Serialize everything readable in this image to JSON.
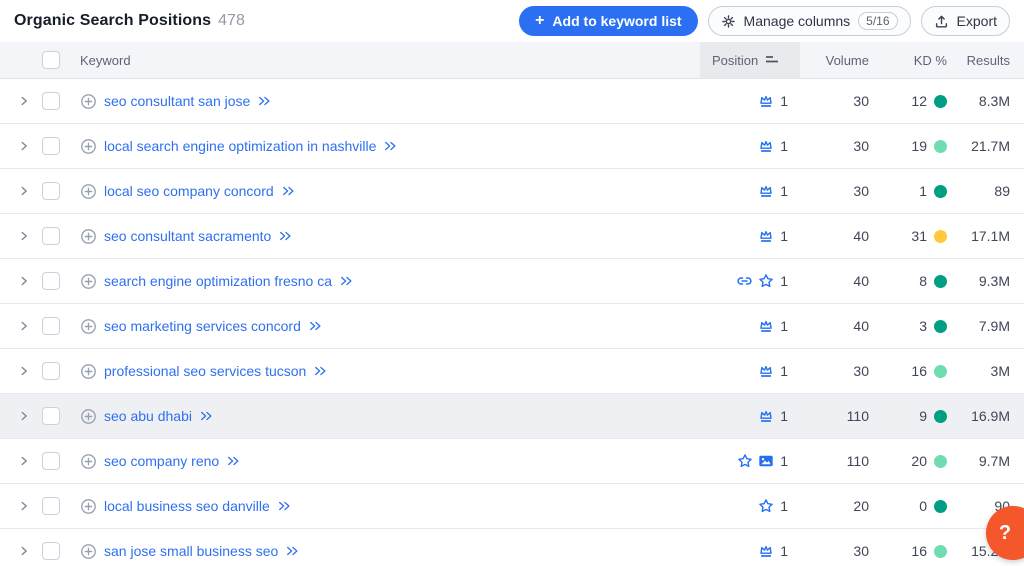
{
  "header": {
    "title": "Organic Search Positions",
    "count": "478"
  },
  "toolbar": {
    "add_button": "Add to keyword list",
    "add_plus": "+",
    "manage_columns": "Manage columns",
    "columns_badge": "5/16",
    "export": "Export"
  },
  "colors": {
    "accent_blue": "#2b70f3",
    "link_blue": "#2e70f0",
    "kd_very_easy": "#009f81",
    "kd_easy": "#6fdcb1",
    "kd_possible": "#ffc83d",
    "help_orange": "#f4572b"
  },
  "table": {
    "columns": {
      "keyword": "Keyword",
      "position": "Position",
      "volume": "Volume",
      "kd": "KD %",
      "results": "Results"
    },
    "rows": [
      {
        "keyword": "seo consultant san jose",
        "icons": [
          "crown-icon"
        ],
        "position": "1",
        "volume": "30",
        "kd": "12",
        "kd_level": "very_easy",
        "results": "8.3M",
        "highlighted": false
      },
      {
        "keyword": "local search engine optimization in nashville",
        "icons": [
          "crown-icon"
        ],
        "position": "1",
        "volume": "30",
        "kd": "19",
        "kd_level": "easy",
        "results": "21.7M",
        "highlighted": false
      },
      {
        "keyword": "local seo company concord",
        "icons": [
          "crown-icon"
        ],
        "position": "1",
        "volume": "30",
        "kd": "1",
        "kd_level": "very_easy",
        "results": "89",
        "highlighted": false
      },
      {
        "keyword": "seo consultant sacramento",
        "icons": [
          "crown-icon"
        ],
        "position": "1",
        "volume": "40",
        "kd": "31",
        "kd_level": "possible",
        "results": "17.1M",
        "highlighted": false
      },
      {
        "keyword": "search engine optimization fresno ca",
        "icons": [
          "sitelinks-icon",
          "star-icon"
        ],
        "position": "1",
        "volume": "40",
        "kd": "8",
        "kd_level": "very_easy",
        "results": "9.3M",
        "highlighted": false
      },
      {
        "keyword": "seo marketing services concord",
        "icons": [
          "crown-icon"
        ],
        "position": "1",
        "volume": "40",
        "kd": "3",
        "kd_level": "very_easy",
        "results": "7.9M",
        "highlighted": false
      },
      {
        "keyword": "professional seo services tucson",
        "icons": [
          "crown-icon"
        ],
        "position": "1",
        "volume": "30",
        "kd": "16",
        "kd_level": "easy",
        "results": "3M",
        "highlighted": false
      },
      {
        "keyword": "seo abu dhabi",
        "icons": [
          "crown-icon"
        ],
        "position": "1",
        "volume": "110",
        "kd": "9",
        "kd_level": "very_easy",
        "results": "16.9M",
        "highlighted": true
      },
      {
        "keyword": "seo company reno",
        "icons": [
          "star-icon",
          "image-pack-icon"
        ],
        "position": "1",
        "volume": "110",
        "kd": "20",
        "kd_level": "easy",
        "results": "9.7M",
        "highlighted": false
      },
      {
        "keyword": "local business seo danville",
        "icons": [
          "star-icon"
        ],
        "position": "1",
        "volume": "20",
        "kd": "0",
        "kd_level": "very_easy",
        "results": "90",
        "highlighted": false
      },
      {
        "keyword": "san jose small business seo",
        "icons": [
          "crown-icon"
        ],
        "position": "1",
        "volume": "30",
        "kd": "16",
        "kd_level": "easy",
        "results": "15.2M",
        "highlighted": false
      }
    ]
  },
  "help": {
    "label": "?"
  }
}
